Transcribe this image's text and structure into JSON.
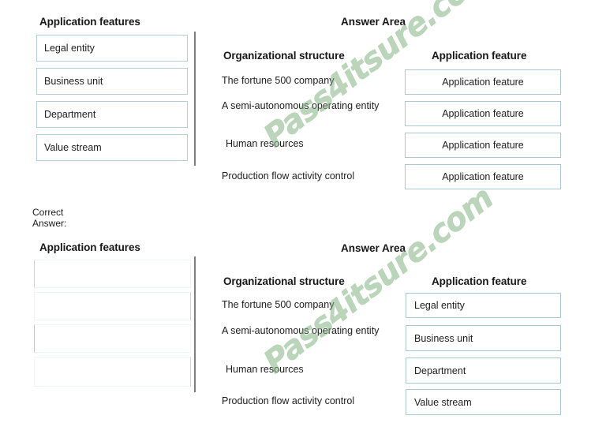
{
  "watermark": {
    "text": "Pass4itsure.com",
    "color": "#7cb07c"
  },
  "question": {
    "left_panel": {
      "heading": "Application features",
      "items": [
        {
          "label": "Legal entity"
        },
        {
          "label": "Business unit"
        },
        {
          "label": "Department"
        },
        {
          "label": "Value stream"
        }
      ]
    },
    "answer_area": {
      "heading": "Answer Area",
      "org_column_heading": "Organizational structure",
      "feature_column_heading": "Application feature",
      "org_items": [
        {
          "label": "The fortune 500 company"
        },
        {
          "label": "A semi-autonomous operating entity"
        },
        {
          "label": "Human resources"
        },
        {
          "label": "Production flow activity control"
        }
      ],
      "answer_slots": [
        {
          "label": "Application feature"
        },
        {
          "label": "Application feature"
        },
        {
          "label": "Application feature"
        },
        {
          "label": "Application feature"
        }
      ]
    }
  },
  "correct_answer": {
    "label": "Correct Answer:",
    "left_panel": {
      "heading": "Application features",
      "items": [
        {
          "label": ""
        },
        {
          "label": ""
        },
        {
          "label": ""
        },
        {
          "label": ""
        }
      ]
    },
    "answer_area": {
      "heading": "Answer Area",
      "org_column_heading": "Organizational structure",
      "feature_column_heading": "Application feature",
      "org_items": [
        {
          "label": "The fortune 500 company"
        },
        {
          "label": "A semi-autonomous operating entity"
        },
        {
          "label": "Human resources"
        },
        {
          "label": "Production flow activity control"
        }
      ],
      "answer_slots": [
        {
          "label": "Legal entity"
        },
        {
          "label": "Business unit"
        },
        {
          "label": "Department"
        },
        {
          "label": "Value stream"
        }
      ]
    }
  }
}
